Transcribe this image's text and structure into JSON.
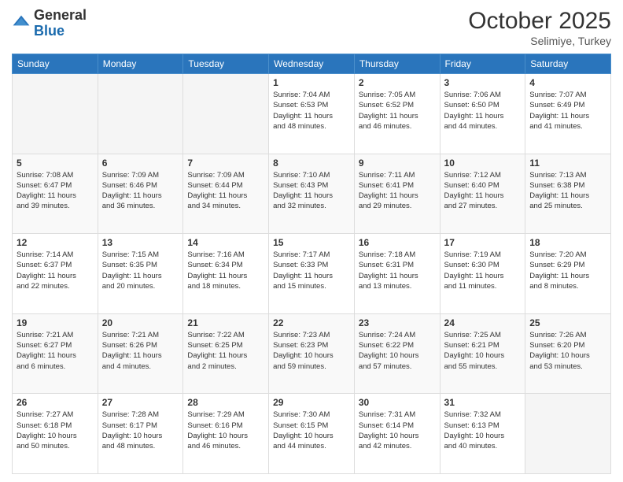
{
  "logo": {
    "general": "General",
    "blue": "Blue"
  },
  "header": {
    "month": "October 2025",
    "location": "Selimiye, Turkey"
  },
  "weekdays": [
    "Sunday",
    "Monday",
    "Tuesday",
    "Wednesday",
    "Thursday",
    "Friday",
    "Saturday"
  ],
  "weeks": [
    {
      "shade": false,
      "days": [
        {
          "num": "",
          "info": "",
          "empty": true
        },
        {
          "num": "",
          "info": "",
          "empty": true
        },
        {
          "num": "",
          "info": "",
          "empty": true
        },
        {
          "num": "1",
          "info": "Sunrise: 7:04 AM\nSunset: 6:53 PM\nDaylight: 11 hours\nand 48 minutes.",
          "empty": false
        },
        {
          "num": "2",
          "info": "Sunrise: 7:05 AM\nSunset: 6:52 PM\nDaylight: 11 hours\nand 46 minutes.",
          "empty": false
        },
        {
          "num": "3",
          "info": "Sunrise: 7:06 AM\nSunset: 6:50 PM\nDaylight: 11 hours\nand 44 minutes.",
          "empty": false
        },
        {
          "num": "4",
          "info": "Sunrise: 7:07 AM\nSunset: 6:49 PM\nDaylight: 11 hours\nand 41 minutes.",
          "empty": false
        }
      ]
    },
    {
      "shade": true,
      "days": [
        {
          "num": "5",
          "info": "Sunrise: 7:08 AM\nSunset: 6:47 PM\nDaylight: 11 hours\nand 39 minutes.",
          "empty": false
        },
        {
          "num": "6",
          "info": "Sunrise: 7:09 AM\nSunset: 6:46 PM\nDaylight: 11 hours\nand 36 minutes.",
          "empty": false
        },
        {
          "num": "7",
          "info": "Sunrise: 7:09 AM\nSunset: 6:44 PM\nDaylight: 11 hours\nand 34 minutes.",
          "empty": false
        },
        {
          "num": "8",
          "info": "Sunrise: 7:10 AM\nSunset: 6:43 PM\nDaylight: 11 hours\nand 32 minutes.",
          "empty": false
        },
        {
          "num": "9",
          "info": "Sunrise: 7:11 AM\nSunset: 6:41 PM\nDaylight: 11 hours\nand 29 minutes.",
          "empty": false
        },
        {
          "num": "10",
          "info": "Sunrise: 7:12 AM\nSunset: 6:40 PM\nDaylight: 11 hours\nand 27 minutes.",
          "empty": false
        },
        {
          "num": "11",
          "info": "Sunrise: 7:13 AM\nSunset: 6:38 PM\nDaylight: 11 hours\nand 25 minutes.",
          "empty": false
        }
      ]
    },
    {
      "shade": false,
      "days": [
        {
          "num": "12",
          "info": "Sunrise: 7:14 AM\nSunset: 6:37 PM\nDaylight: 11 hours\nand 22 minutes.",
          "empty": false
        },
        {
          "num": "13",
          "info": "Sunrise: 7:15 AM\nSunset: 6:35 PM\nDaylight: 11 hours\nand 20 minutes.",
          "empty": false
        },
        {
          "num": "14",
          "info": "Sunrise: 7:16 AM\nSunset: 6:34 PM\nDaylight: 11 hours\nand 18 minutes.",
          "empty": false
        },
        {
          "num": "15",
          "info": "Sunrise: 7:17 AM\nSunset: 6:33 PM\nDaylight: 11 hours\nand 15 minutes.",
          "empty": false
        },
        {
          "num": "16",
          "info": "Sunrise: 7:18 AM\nSunset: 6:31 PM\nDaylight: 11 hours\nand 13 minutes.",
          "empty": false
        },
        {
          "num": "17",
          "info": "Sunrise: 7:19 AM\nSunset: 6:30 PM\nDaylight: 11 hours\nand 11 minutes.",
          "empty": false
        },
        {
          "num": "18",
          "info": "Sunrise: 7:20 AM\nSunset: 6:29 PM\nDaylight: 11 hours\nand 8 minutes.",
          "empty": false
        }
      ]
    },
    {
      "shade": true,
      "days": [
        {
          "num": "19",
          "info": "Sunrise: 7:21 AM\nSunset: 6:27 PM\nDaylight: 11 hours\nand 6 minutes.",
          "empty": false
        },
        {
          "num": "20",
          "info": "Sunrise: 7:21 AM\nSunset: 6:26 PM\nDaylight: 11 hours\nand 4 minutes.",
          "empty": false
        },
        {
          "num": "21",
          "info": "Sunrise: 7:22 AM\nSunset: 6:25 PM\nDaylight: 11 hours\nand 2 minutes.",
          "empty": false
        },
        {
          "num": "22",
          "info": "Sunrise: 7:23 AM\nSunset: 6:23 PM\nDaylight: 10 hours\nand 59 minutes.",
          "empty": false
        },
        {
          "num": "23",
          "info": "Sunrise: 7:24 AM\nSunset: 6:22 PM\nDaylight: 10 hours\nand 57 minutes.",
          "empty": false
        },
        {
          "num": "24",
          "info": "Sunrise: 7:25 AM\nSunset: 6:21 PM\nDaylight: 10 hours\nand 55 minutes.",
          "empty": false
        },
        {
          "num": "25",
          "info": "Sunrise: 7:26 AM\nSunset: 6:20 PM\nDaylight: 10 hours\nand 53 minutes.",
          "empty": false
        }
      ]
    },
    {
      "shade": false,
      "days": [
        {
          "num": "26",
          "info": "Sunrise: 7:27 AM\nSunset: 6:18 PM\nDaylight: 10 hours\nand 50 minutes.",
          "empty": false
        },
        {
          "num": "27",
          "info": "Sunrise: 7:28 AM\nSunset: 6:17 PM\nDaylight: 10 hours\nand 48 minutes.",
          "empty": false
        },
        {
          "num": "28",
          "info": "Sunrise: 7:29 AM\nSunset: 6:16 PM\nDaylight: 10 hours\nand 46 minutes.",
          "empty": false
        },
        {
          "num": "29",
          "info": "Sunrise: 7:30 AM\nSunset: 6:15 PM\nDaylight: 10 hours\nand 44 minutes.",
          "empty": false
        },
        {
          "num": "30",
          "info": "Sunrise: 7:31 AM\nSunset: 6:14 PM\nDaylight: 10 hours\nand 42 minutes.",
          "empty": false
        },
        {
          "num": "31",
          "info": "Sunrise: 7:32 AM\nSunset: 6:13 PM\nDaylight: 10 hours\nand 40 minutes.",
          "empty": false
        },
        {
          "num": "",
          "info": "",
          "empty": true
        }
      ]
    }
  ]
}
